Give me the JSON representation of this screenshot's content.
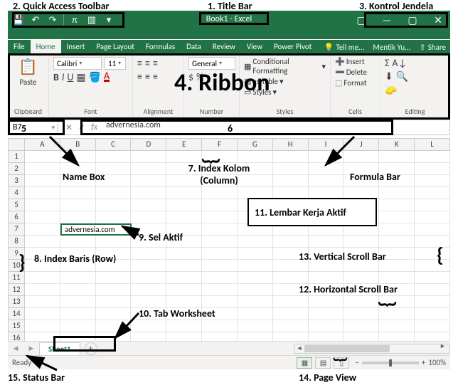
{
  "ann": {
    "titleBar": "1. Title Bar",
    "qat": "2. Quick Access Toolbar",
    "winctrl": "3. Kontrol Jendela",
    "ribbon": "4. Ribbon",
    "num5": "5",
    "num6": "6",
    "nameBox": "Name Box",
    "colIdx": "7. Index Kolom (Column)",
    "rowIdx": "8. Index Baris (Row)",
    "activeCell": "9. Sel Aktif",
    "tabWorksheet": "10. Tab Worksheet",
    "activeSheet": "11. Lembar Kerja Aktif",
    "hscroll": "12. Horizontal Scroll Bar",
    "vscroll": "13. Vertical Scroll Bar",
    "pageView": "14. Page View",
    "statusBar": "15. Status Bar",
    "formulaBar": "Formula Bar"
  },
  "title": "Book1 - Excel",
  "tabs": [
    "File",
    "Home",
    "Insert",
    "Page Layout",
    "Formulas",
    "Data",
    "Review",
    "View",
    "Power Pivot"
  ],
  "rightLinks": {
    "tell": "Tell me...",
    "user": "Mentik Yu...",
    "share": "Share"
  },
  "activeTabIndex": 1,
  "ribbonGroups": {
    "clipboard": {
      "label": "Clipboard",
      "paste": "Paste"
    },
    "font": {
      "label": "Font",
      "name": "Calibri",
      "size": "11"
    },
    "alignment": {
      "label": "Alignment"
    },
    "number": {
      "label": "Number",
      "format": "General"
    },
    "styles": {
      "label": "Styles",
      "cond": "Conditional Formatting",
      "table": "as Table",
      "cellStyles": "Styles"
    },
    "cells": {
      "label": "Cells",
      "insert": "Insert",
      "delete": "Delete",
      "format": "Format"
    },
    "editing": {
      "label": "Editing"
    }
  },
  "namebox": "B7",
  "formula": "advernesia.com",
  "columns": [
    "A",
    "B",
    "C",
    "D",
    "E",
    "F",
    "G",
    "H",
    "I",
    "J",
    "K",
    "L"
  ],
  "rows": [
    1,
    2,
    3,
    4,
    5,
    6,
    7,
    8,
    9,
    10,
    11,
    12,
    13,
    14,
    15,
    16
  ],
  "activeCellValue": "advernesia.com",
  "sheet": {
    "name": "Sheet1"
  },
  "status": {
    "ready": "Ready",
    "zoom": "100%"
  }
}
